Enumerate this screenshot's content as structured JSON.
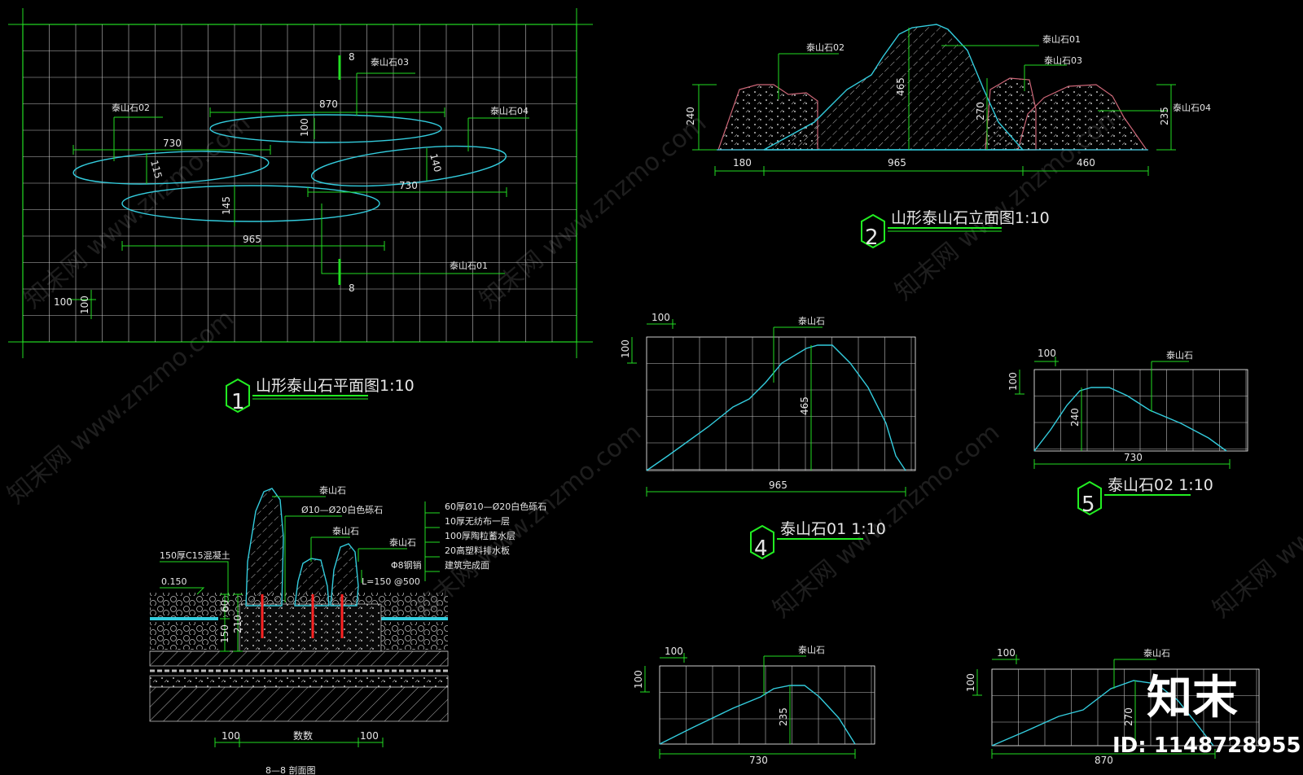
{
  "colors": {
    "grid": "#ffffff",
    "frame": "#22dd22",
    "stone": "#33ccdd",
    "dim": "#22dd22",
    "rock_outline": "#cc6677",
    "rebar": "#ff2222",
    "hatch": "#cccccc"
  },
  "plan": {
    "title": "山形泰山石平面图1:10",
    "number": "1",
    "dims": {
      "d870": "870",
      "d730a": "730",
      "d730b": "730",
      "d965": "965",
      "d100": "100",
      "d115": "115",
      "d145": "145",
      "d140": "140",
      "grid100a": "100",
      "grid100b": "100",
      "sec_a": "8",
      "sec_b": "8"
    },
    "labels": {
      "s1": "泰山石01",
      "s2": "泰山石02",
      "s3": "泰山石03",
      "s4": "泰山石04"
    }
  },
  "elevation": {
    "title": "山形泰山石立面图1:10",
    "number": "2",
    "dims": {
      "d240": "240",
      "d465": "465",
      "d270": "270",
      "d235": "235",
      "d180": "180",
      "d965": "965",
      "d460": "460"
    },
    "labels": {
      "s1": "泰山石01",
      "s2": "泰山石02",
      "s3": "泰山石03",
      "s4": "泰山石04"
    }
  },
  "stone1": {
    "title": "泰山石01 1:10",
    "number": "4",
    "label": "泰山石",
    "dims": {
      "grid": "100",
      "gridv": "100",
      "h": "465",
      "w": "965"
    }
  },
  "stone2": {
    "title": "泰山石02 1:10",
    "number": "5",
    "label": "泰山石",
    "dims": {
      "grid": "100",
      "gridv": "100",
      "h": "240",
      "w": "730"
    }
  },
  "stone3": {
    "label": "泰山石",
    "dims": {
      "grid": "100",
      "gridv": "100",
      "h": "235",
      "w": "730"
    }
  },
  "stone4": {
    "label": "泰山石",
    "dims": {
      "grid": "100",
      "gridv": "100",
      "h": "270",
      "w": "870"
    }
  },
  "section": {
    "title": "8—8 剖面图",
    "labels": {
      "stone_a": "泰山石",
      "stone_b": "泰山石",
      "stone_c": "泰山石",
      "gravel": "Ø10—Ø20白色砾石",
      "concrete": "150厚C15混凝土",
      "level": "0.150",
      "rebar": "Φ8钢销",
      "rebar_spec": "L=150 @500"
    },
    "layers": [
      "60厚Ø10—Ø20白色砾石",
      "10厚无纺布一层",
      "100厚陶粒蓄水层",
      "20高塑料排水板",
      "建筑完成面"
    ],
    "dims": {
      "d60": "60",
      "d150": "150",
      "d210": "210",
      "w100a": "100",
      "wmid": "数数",
      "w100b": "100"
    }
  },
  "watermark": {
    "text": "知末网 www.znzmo.com",
    "brand": "知末",
    "id": "ID: 1148728955"
  }
}
